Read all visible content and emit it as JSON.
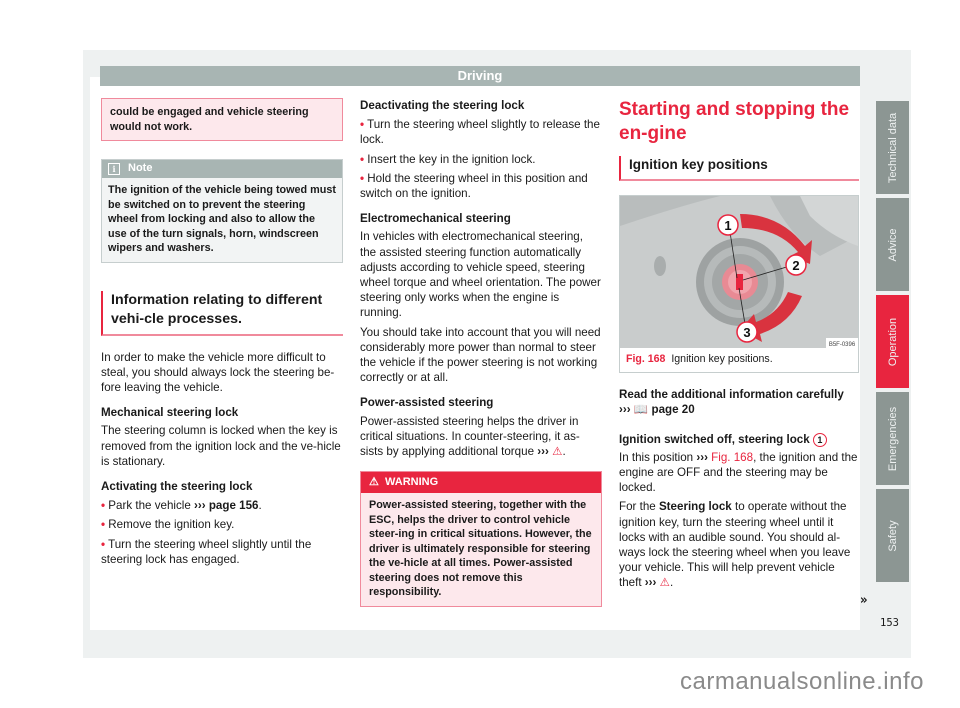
{
  "header": {
    "title": "Driving"
  },
  "column1": {
    "top_callout": "could be engaged and vehicle steering would not work.",
    "note": {
      "label": "Note",
      "icon": "info-icon",
      "text": "The ignition of the vehicle being towed must be switched on to prevent the steering wheel from locking and also to allow the use of the turn signals, horn, windscreen wipers and washers."
    },
    "section_heading": "Information relating to different vehi-cle processes.",
    "intro": "In order to make the vehicle more difficult to steal, you should always lock the steering be-fore leaving the vehicle.",
    "mechanical": {
      "heading": "Mechanical steering lock",
      "text": "The steering column is locked when the key is removed from the ignition lock and the ve-hicle is stationary."
    },
    "activating": {
      "heading": "Activating the steering lock",
      "bullets": [
        {
          "text": "Park the vehicle ",
          "arrow": "›››",
          "link": "page 156",
          "tail": "."
        },
        {
          "text": "Remove the ignition key."
        },
        {
          "text": "Turn the steering wheel slightly until the steering lock has engaged."
        }
      ]
    }
  },
  "column2": {
    "deactivating": {
      "heading": "Deactivating the steering lock",
      "bullets": [
        "Turn the steering wheel slightly to release the lock.",
        "Insert the key in the ignition lock.",
        "Hold the steering wheel in this position and switch on the ignition."
      ]
    },
    "electromechanical": {
      "heading": "Electromechanical steering",
      "p1": "In vehicles with electromechanical steering, the assisted steering function automatically adjusts according to vehicle speed, steering wheel torque and wheel orientation. The power steering only works when the engine is running.",
      "p2": "You should take into account that you will need considerably more power than normal to steer the vehicle if the power steering is not working correctly or at all."
    },
    "power_assisted": {
      "heading": "Power-assisted steering",
      "text": "Power-assisted steering helps the driver in critical situations. In counter-steering, it as-sists by applying additional torque",
      "arrow": "›››",
      "warn_symbol": "⚠"
    },
    "warning": {
      "label": "WARNING",
      "icon": "warning-icon",
      "text": "Power-assisted steering, together with the ESC, helps the driver to control vehicle steer-ing in critical situations. However, the driver is ultimately responsible for steering the ve-hicle at all times. Power-assisted steering does not remove this responsibility."
    }
  },
  "column3": {
    "title": "Starting and stopping the en-gine",
    "subtitle": "Ignition key positions",
    "figure": {
      "code": "B5F-0396",
      "caption_label": "Fig. 168",
      "caption_text": "Ignition key positions.",
      "callouts": [
        "1",
        "2",
        "3"
      ]
    },
    "read_more": {
      "text": "Read the additional information carefully",
      "arrow": "›››",
      "link": "page 20"
    },
    "ignition_off": {
      "heading": "Ignition switched off, steering lock",
      "badge": "1",
      "p1_pre": "In this position ",
      "p1_arrow": "›››",
      "p1_link": "Fig. 168",
      "p1_post": ", the ignition and the engine are OFF and the steering may be locked.",
      "p2_pre": "For the ",
      "p2_bold": "Steering lock",
      "p2_post": " to operate without the ignition key, turn the steering wheel until it locks with an audible sound. You should al-ways lock the steering wheel when you leave your vehicle. This will help prevent vehicle theft",
      "p2_arrow": "›››",
      "warn_symbol": "⚠"
    },
    "continued": "»"
  },
  "side_tabs": [
    {
      "label": "Technical data",
      "active": false
    },
    {
      "label": "Advice",
      "active": false
    },
    {
      "label": "Operation",
      "active": true
    },
    {
      "label": "Emergencies",
      "active": false
    },
    {
      "label": "Safety",
      "active": false
    }
  ],
  "page_number": "153",
  "watermark": "carmanualsonline.info"
}
